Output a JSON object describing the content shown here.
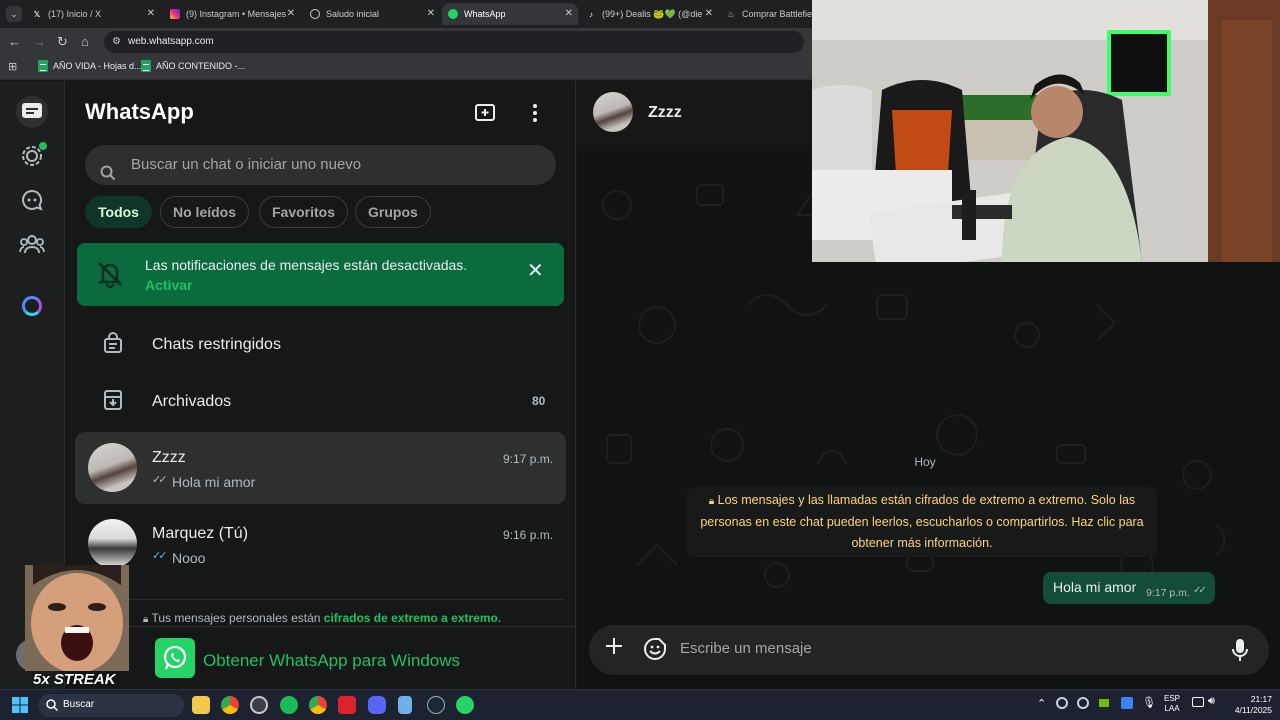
{
  "browser": {
    "tabs": [
      {
        "title": "(17) Inicio / X",
        "icon": "x-logo-icon",
        "active": false
      },
      {
        "title": "(9) Instagram • Mensajes",
        "icon": "instagram-icon",
        "active": false
      },
      {
        "title": "Saludo inicial",
        "icon": "chatgpt-icon",
        "active": false
      },
      {
        "title": "WhatsApp",
        "icon": "whatsapp-icon",
        "active": true
      },
      {
        "title": "(99+) Dealis 🐸💚 (@die",
        "icon": "tiktok-icon",
        "active": false
      },
      {
        "title": "Comprar Battlefield™",
        "icon": "steam-icon",
        "active": false
      }
    ],
    "url": "web.whatsapp.com",
    "bookmarks": [
      {
        "label": "AÑO VIDA - Hojas d...",
        "icon": "google-sheets-icon"
      },
      {
        "label": "AÑO CONTENIDO -...",
        "icon": "google-sheets-icon"
      }
    ]
  },
  "sidebar": {
    "title": "WhatsApp",
    "search_placeholder": "Buscar un chat o iniciar uno nuevo",
    "filters": [
      "Todos",
      "No leídos",
      "Favoritos",
      "Grupos"
    ],
    "active_filter": "Todos",
    "notification": {
      "text": "Las notificaciones de mensajes están desactivadas.",
      "action": "Activar"
    },
    "restricted_label": "Chats restringidos",
    "archived_label": "Archivados",
    "archived_count": "80",
    "chats": [
      {
        "name": "Zzzz",
        "time": "9:17 p.m.",
        "preview": "Hola mi amor",
        "selected": true
      },
      {
        "name": "Marquez (Tú)",
        "time": "9:16 p.m.",
        "preview": "Nooo",
        "selected": false
      }
    ],
    "encryption_prefix": "Tus mensajes personales están",
    "encryption_link": "cifrados de extremo a extremo",
    "get_app_label": "Obtener WhatsApp para Windows"
  },
  "chat": {
    "contact_name": "Zzzz",
    "date_divider": "Hoy",
    "system_message": "Los mensajes y las llamadas están cifrados de extremo a extremo. Solo las personas en este chat pueden leerlos, escucharlos o compartirlos. Haz clic para obtener más información.",
    "messages": [
      {
        "text": "Hola mi amor",
        "time": "9:17 p.m.",
        "outgoing": true,
        "status": "read"
      }
    ],
    "composer_placeholder": "Escribe un mensaje"
  },
  "overlay": {
    "streak_label": "5x STREAK"
  },
  "taskbar": {
    "search_label": "Buscar",
    "lang_top": "ESP",
    "lang_bottom": "LAA",
    "time": "21:17",
    "date": "4/11/2025",
    "apps": [
      "file-explorer-icon",
      "chrome-icon",
      "obs-icon",
      "spotify-icon",
      "chrome-alt-icon",
      "app-red-icon",
      "discord-icon",
      "notepad-icon",
      "steam-icon",
      "whatsapp-icon"
    ]
  },
  "colors": {
    "accent": "#21c063",
    "notif_bg": "#0b6b3f",
    "bubble_out": "#144d37",
    "panel_bg": "#161717",
    "chat_bg": "#111313"
  }
}
